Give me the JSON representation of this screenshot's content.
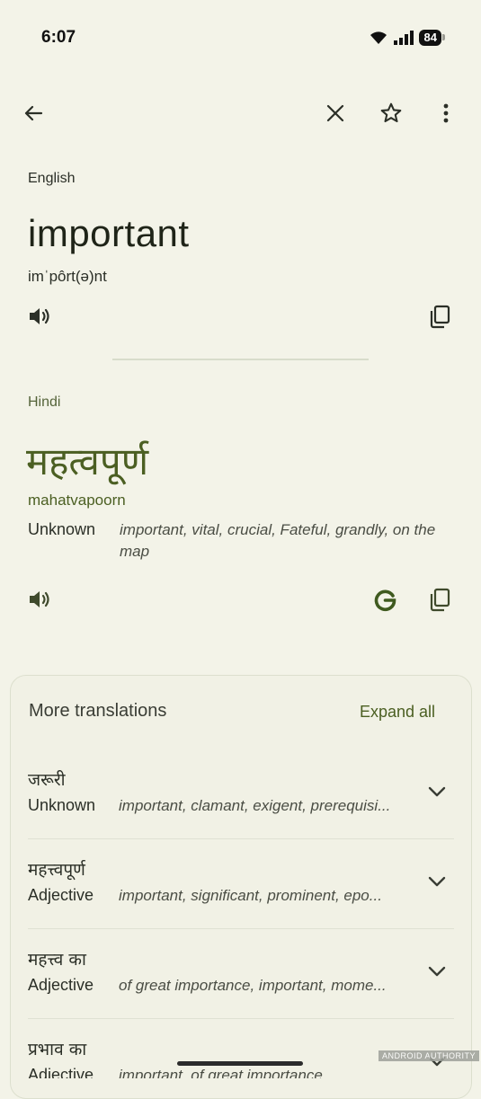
{
  "status_bar": {
    "time": "6:07",
    "battery": "84"
  },
  "icons": {
    "back": "arrow-back-icon",
    "close": "close-icon",
    "star": "star-icon",
    "more": "more-vert-icon",
    "speaker": "speaker-icon",
    "copy": "copy-icon",
    "google": "google-icon",
    "chevron": "chevron-down-icon"
  },
  "source": {
    "language": "English",
    "word": "important",
    "phonetic": "imˈpôrt(ə)nt"
  },
  "target": {
    "language": "Hindi",
    "word": "महत्वपूर्ण",
    "transliteration": "mahatvapoorn",
    "part_of_speech": "Unknown",
    "synonyms": "important, vital, crucial, Fateful, grandly, on the map"
  },
  "more_translations": {
    "title": "More translations",
    "expand_label": "Expand all",
    "items": [
      {
        "word": "जरूरी",
        "pos": "Unknown",
        "synonyms": "important, clamant, exigent, prerequisi..."
      },
      {
        "word": "महत्त्वपूर्ण",
        "pos": "Adjective",
        "synonyms": "important, significant, prominent, epo..."
      },
      {
        "word": "महत्त्व का",
        "pos": "Adjective",
        "synonyms": "of great importance, important, mome..."
      },
      {
        "word": "प्रभाव का",
        "pos": "Adjective",
        "synonyms": "important, of great importance"
      }
    ]
  },
  "watermark": "ANDROID AUTHORITY",
  "colors": {
    "background": "#f3f3e8",
    "accent": "#4b5f22",
    "text": "#1f2418"
  }
}
